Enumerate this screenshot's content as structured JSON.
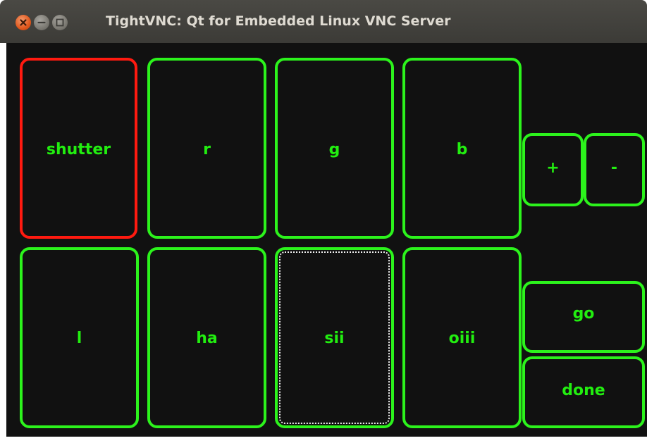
{
  "window": {
    "title": "TightVNC: Qt for Embedded Linux VNC Server",
    "buttons": [
      "close",
      "minimize",
      "maximize"
    ]
  },
  "theme": {
    "background": "#111111",
    "accent": "#2cf31c",
    "text": "#22ee10",
    "active_border": "#ff1a10"
  },
  "keys": {
    "shutter": "shutter",
    "r": "r",
    "g": "g",
    "b": "b",
    "plus": "+",
    "minus": "-",
    "l": "l",
    "ha": "ha",
    "sii": "sii",
    "oiii": "oiii",
    "go": "go",
    "done": "done"
  },
  "state": {
    "active_key": "shutter",
    "focused_key": "sii"
  }
}
